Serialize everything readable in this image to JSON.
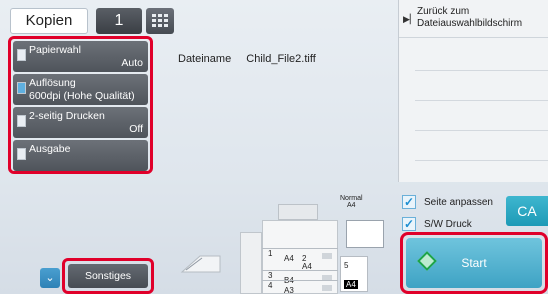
{
  "header": {
    "copies_label": "Kopien",
    "copies_count": "1"
  },
  "settings": {
    "paper": {
      "label": "Papierwahl",
      "value": "Auto"
    },
    "resolution": {
      "label": "Auflösung",
      "value": "600dpi (Hohe Qualität)"
    },
    "duplex": {
      "label": "2-seitig Drucken",
      "value": "Off"
    },
    "output": {
      "label": "Ausgabe"
    }
  },
  "file": {
    "name_label": "Dateiname",
    "name_value": "Child_File2.tiff"
  },
  "right_panel": {
    "back_line1": "Zurück zum",
    "back_line2": "Dateiauswahlbildschirm"
  },
  "preview": {
    "paper_type": "Normal",
    "paper_size": "A4",
    "trays": [
      {
        "num": "1",
        "size": "A4"
      },
      {
        "num": "2",
        "size": "A4"
      },
      {
        "num": "3",
        "size": "B4"
      },
      {
        "num": "4",
        "size": "A3"
      }
    ],
    "side_tray": {
      "num": "5",
      "size": "A4"
    }
  },
  "options": {
    "fit_page": "Seite anpassen",
    "bw_print": "S/W Druck"
  },
  "buttons": {
    "ca": "CA",
    "start": "Start",
    "other": "Sonstiges"
  }
}
